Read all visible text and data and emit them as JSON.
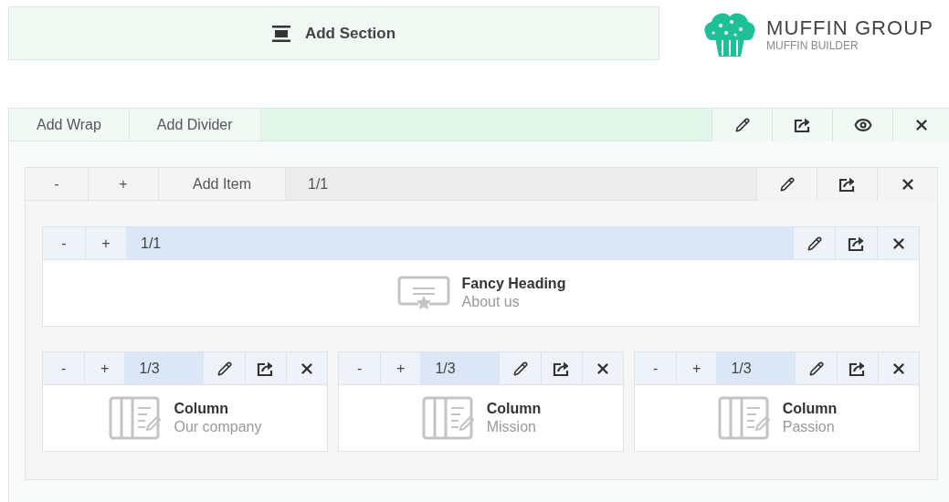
{
  "add_section": {
    "label": "Add Section"
  },
  "logo": {
    "title": "MUFFIN GROUP",
    "subtitle": "MUFFIN BUILDER"
  },
  "section": {
    "buttons": [
      "Add Wrap",
      "Add Divider"
    ],
    "wrap": {
      "minus": "-",
      "plus": "+",
      "add_item": "Add Item",
      "size": "1/1",
      "items": [
        {
          "kind": "heading",
          "minus": "-",
          "plus": "+",
          "size": "1/1",
          "title": "Fancy Heading",
          "subtitle": "About us"
        },
        {
          "kind": "column",
          "minus": "-",
          "plus": "+",
          "size": "1/3",
          "title": "Column",
          "subtitle": "Our company"
        },
        {
          "kind": "column",
          "minus": "-",
          "plus": "+",
          "size": "1/3",
          "title": "Column",
          "subtitle": "Mission"
        },
        {
          "kind": "column",
          "minus": "-",
          "plus": "+",
          "size": "1/3",
          "title": "Column",
          "subtitle": "Passion"
        }
      ]
    }
  }
}
